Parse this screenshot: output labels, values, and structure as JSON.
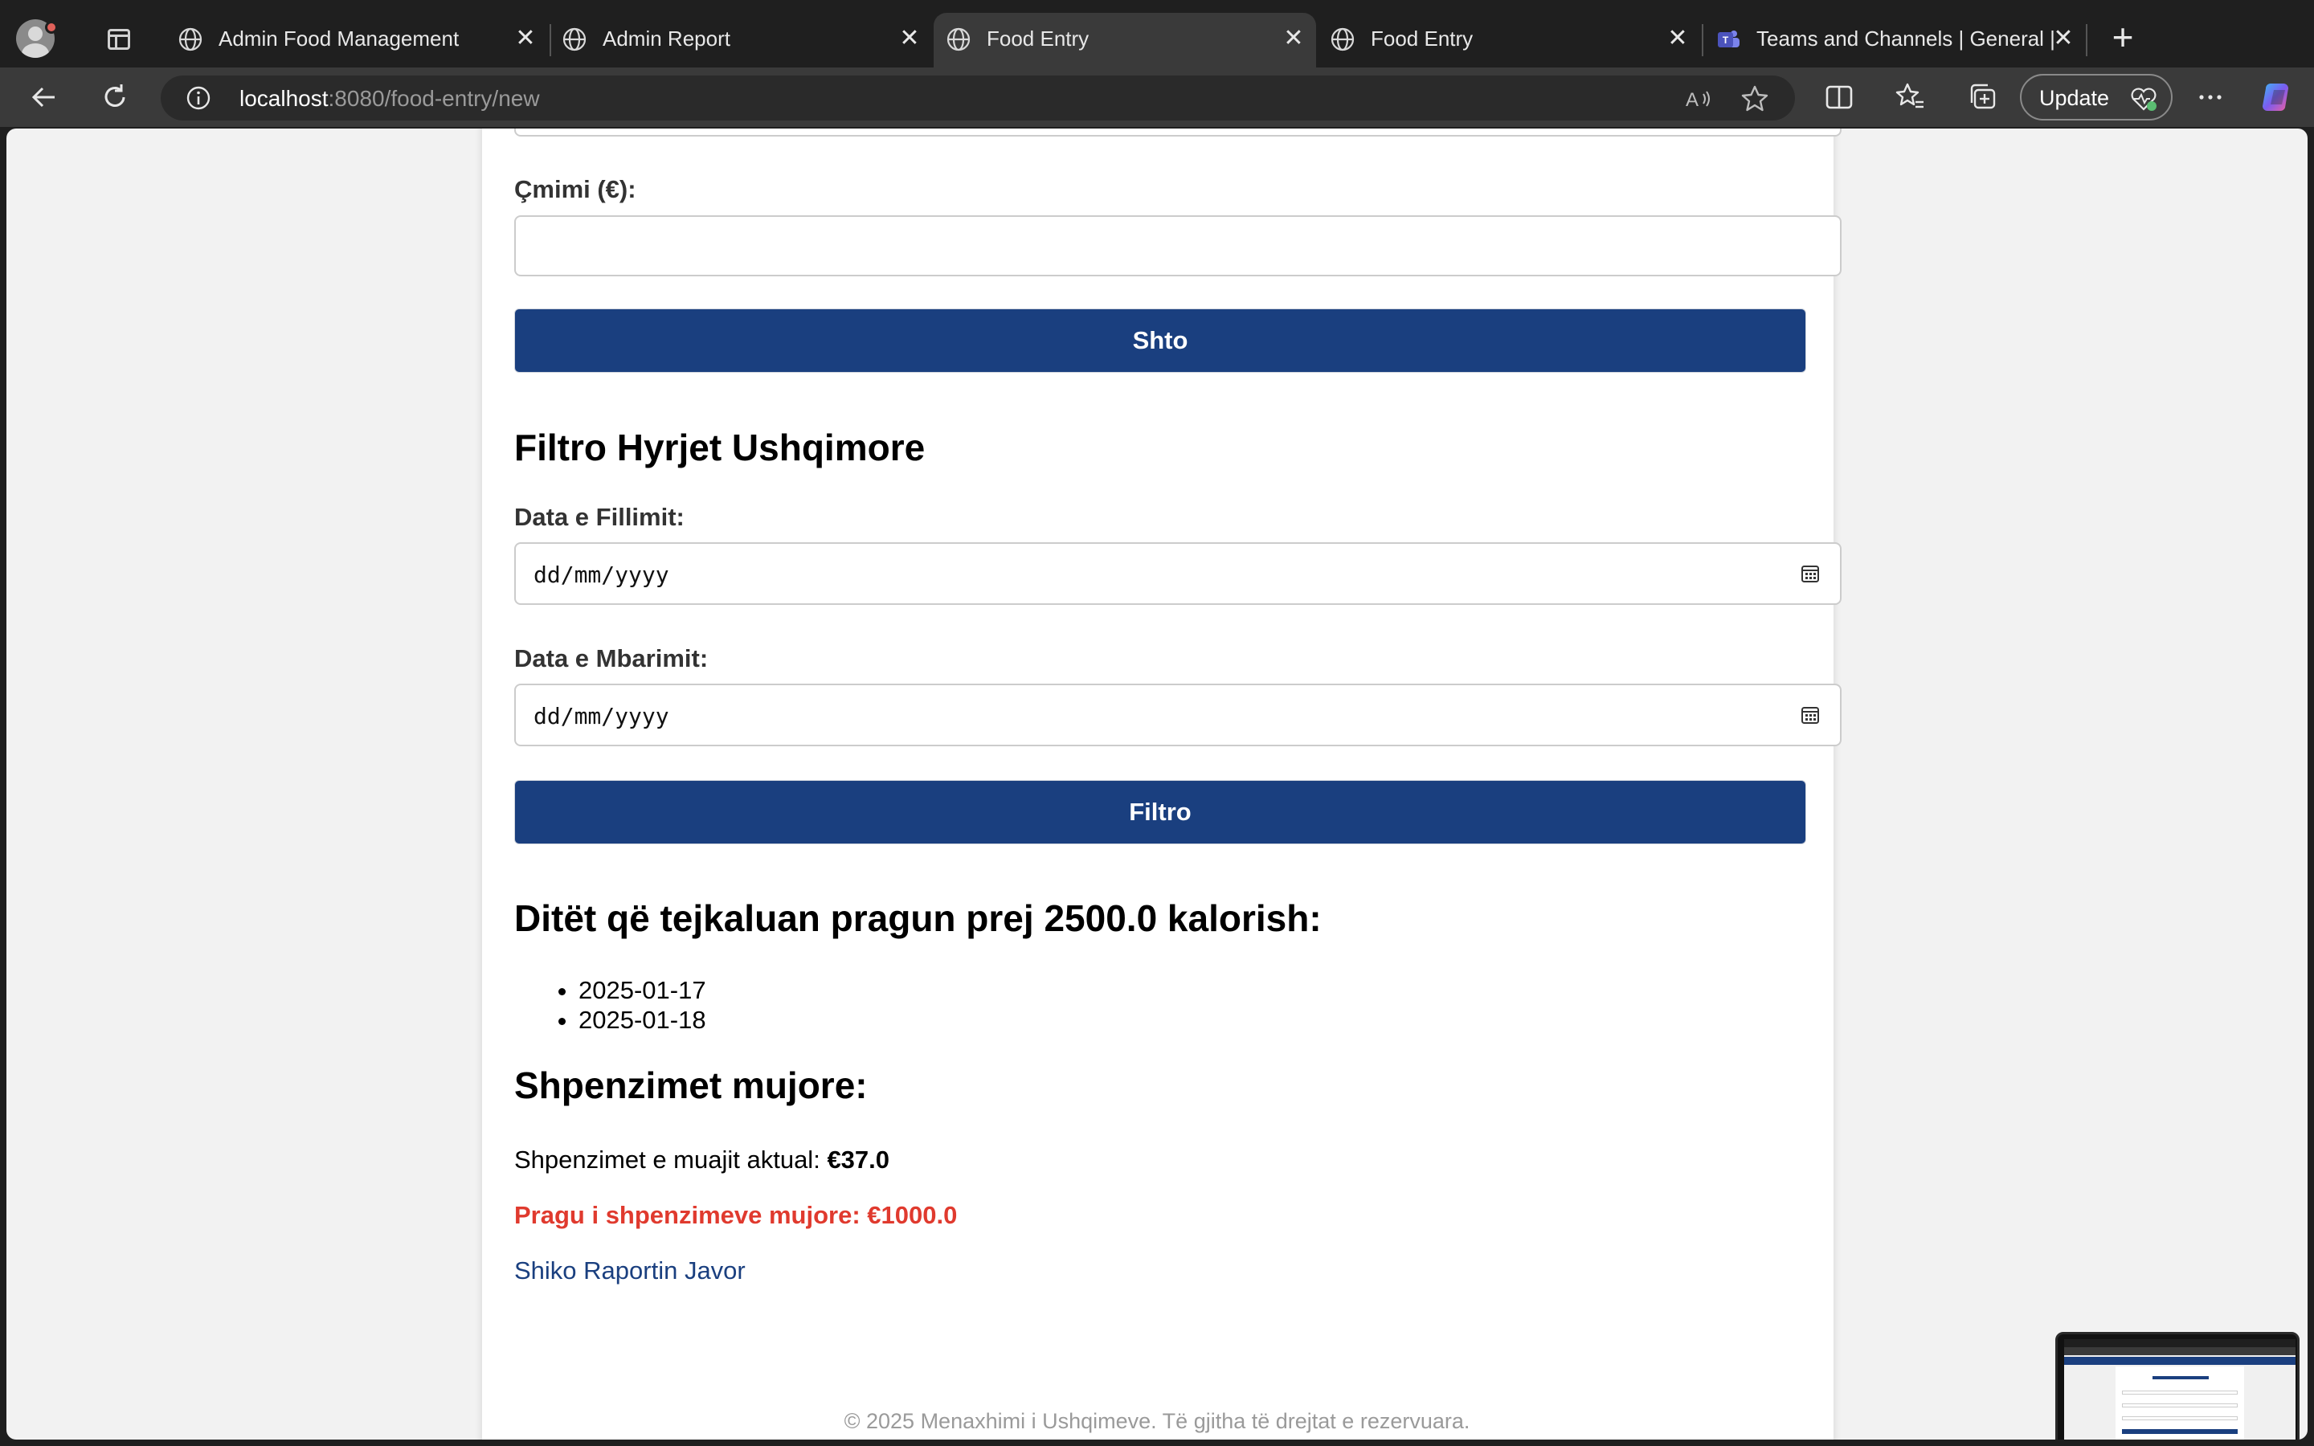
{
  "browser": {
    "tabs": [
      {
        "title": "Admin Food Management",
        "active": false,
        "icon": "globe-icon"
      },
      {
        "title": "Admin Report",
        "active": false,
        "icon": "globe-icon"
      },
      {
        "title": "Food Entry",
        "active": true,
        "icon": "globe-icon"
      },
      {
        "title": "Food Entry",
        "active": false,
        "icon": "globe-icon"
      },
      {
        "title": "Teams and Channels | General |",
        "active": false,
        "icon": "teams-icon"
      }
    ],
    "url_host": "localhost",
    "url_path": ":8080/food-entry/new",
    "update_label": "Update",
    "accent": "#1a3f7f"
  },
  "form": {
    "price_label": "Çmimi (€):",
    "price_value": "",
    "add_button": "Shto"
  },
  "filter": {
    "heading": "Filtro Hyrjet Ushqimore",
    "start_label": "Data e Fillimit:",
    "start_value": "dd/mm/yyyy",
    "end_label": "Data e Mbarimit:",
    "end_value": "dd/mm/yyyy",
    "filter_button": "Filtro"
  },
  "threshold": {
    "heading": "Ditët që tejkaluan pragun prej 2500.0 kalorish:",
    "days": [
      "2025-01-17",
      "2025-01-18"
    ]
  },
  "expenses": {
    "heading": "Shpenzimet mujore:",
    "current_label": "Shpenzimet e muajit aktual: ",
    "current_value": "€37.0",
    "limit_text": "Pragu i shpenzimeve mujore: €1000.0",
    "weekly_link": "Shiko Raportin Javor"
  },
  "footer": {
    "text": "© 2025 Menaxhimi i Ushqimeve. Të gjitha të drejtat e rezervuara."
  }
}
